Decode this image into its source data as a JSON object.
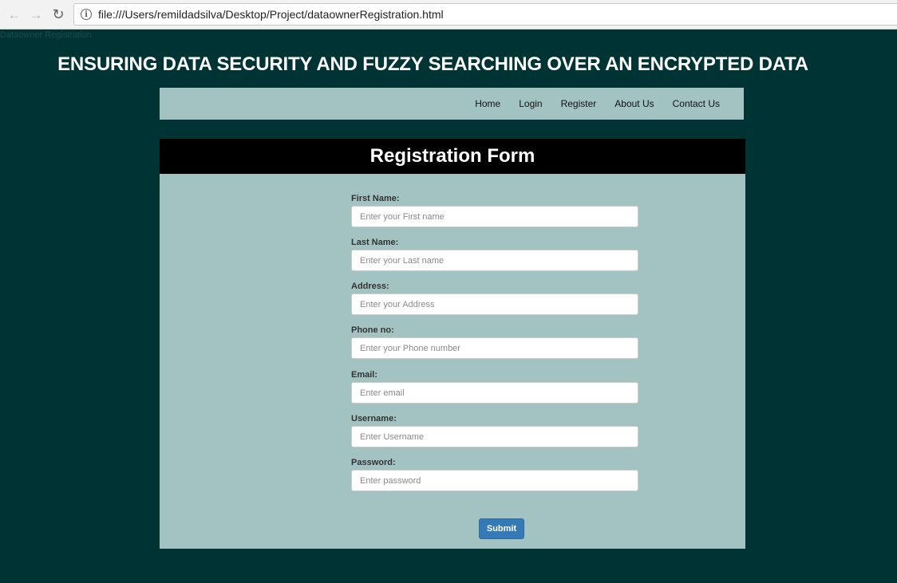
{
  "browser": {
    "back_icon": "←",
    "forward_icon": "→",
    "reload_icon": "↻",
    "url": "file:///Users/remildadsilva/Desktop/Project/dataownerRegistration.html"
  },
  "page": {
    "tab_title": "Dataowner Registration",
    "site_title": "ENSURING DATA SECURITY AND FUZZY SEARCHING OVER AN ENCRYPTED DATA"
  },
  "nav": {
    "items": [
      {
        "label": "Home"
      },
      {
        "label": "Login"
      },
      {
        "label": "Register"
      },
      {
        "label": "About Us"
      },
      {
        "label": "Contact Us"
      }
    ]
  },
  "form": {
    "title": "Registration Form",
    "fields": [
      {
        "label": "First Name:",
        "placeholder": "Enter your First name",
        "value": ""
      },
      {
        "label": "Last Name:",
        "placeholder": "Enter your Last name",
        "value": ""
      },
      {
        "label": "Address:",
        "placeholder": "Enter your Address",
        "value": ""
      },
      {
        "label": "Phone no:",
        "placeholder": "Enter your Phone number",
        "value": ""
      },
      {
        "label": "Email:",
        "placeholder": "Enter email",
        "value": ""
      },
      {
        "label": "Username:",
        "placeholder": "Enter Username",
        "value": ""
      },
      {
        "label": "Password:",
        "placeholder": "Enter password",
        "value": ""
      }
    ],
    "submit_label": "Submit"
  },
  "colors": {
    "page_background": "#003333",
    "panel_background": "#a3c2c2",
    "form_header_background": "#000000",
    "submit_button": "#337ab7"
  }
}
